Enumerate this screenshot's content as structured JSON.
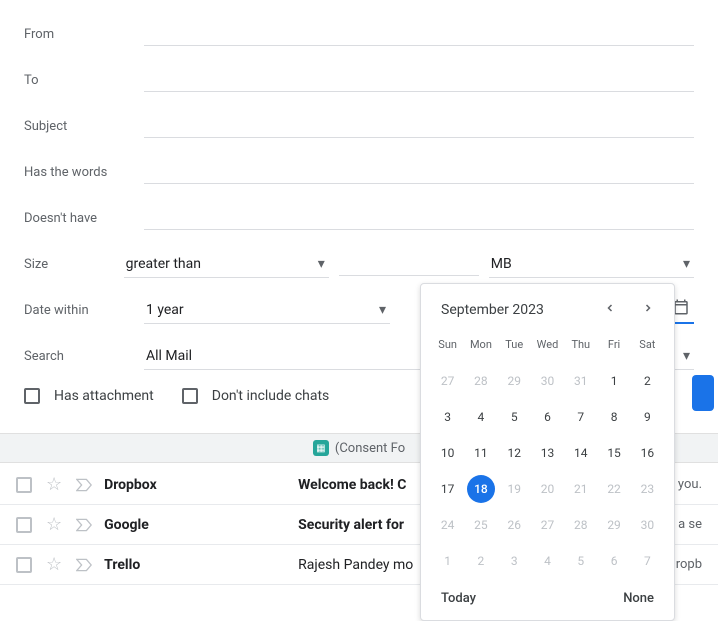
{
  "form": {
    "from_label": "From",
    "from_value": "",
    "to_label": "To",
    "to_value": "",
    "subject_label": "Subject",
    "subject_value": "",
    "has_words_label": "Has the words",
    "has_words_value": "",
    "doesnt_have_label": "Doesn't have",
    "doesnt_have_value": "",
    "size_label": "Size",
    "size_op": "greater than",
    "size_value": "",
    "size_unit": "MB",
    "date_within_label": "Date within",
    "date_within_value": "1 year",
    "date_value": "2023/09/18",
    "search_label": "Search",
    "search_value": "All Mail",
    "has_attachment_label": "Has attachment",
    "dont_include_chats_label": "Don't include chats"
  },
  "datepicker": {
    "title": "September 2023",
    "dow": [
      "Sun",
      "Mon",
      "Tue",
      "Wed",
      "Thu",
      "Fri",
      "Sat"
    ],
    "selected": 18,
    "today_label": "Today",
    "none_label": "None",
    "weeks": [
      [
        {
          "n": 27,
          "m": true
        },
        {
          "n": 28,
          "m": true
        },
        {
          "n": 29,
          "m": true
        },
        {
          "n": 30,
          "m": true
        },
        {
          "n": 31,
          "m": true
        },
        {
          "n": 1
        },
        {
          "n": 2
        }
      ],
      [
        {
          "n": 3
        },
        {
          "n": 4
        },
        {
          "n": 5
        },
        {
          "n": 6
        },
        {
          "n": 7
        },
        {
          "n": 8
        },
        {
          "n": 9
        }
      ],
      [
        {
          "n": 10
        },
        {
          "n": 11
        },
        {
          "n": 12
        },
        {
          "n": 13
        },
        {
          "n": 14
        },
        {
          "n": 15
        },
        {
          "n": 16
        }
      ],
      [
        {
          "n": 17
        },
        {
          "n": 18,
          "sel": true
        },
        {
          "n": 19,
          "m": true
        },
        {
          "n": 20,
          "m": true
        },
        {
          "n": 21,
          "m": true
        },
        {
          "n": 22,
          "m": true
        },
        {
          "n": 23,
          "m": true
        }
      ],
      [
        {
          "n": 24,
          "m": true
        },
        {
          "n": 25,
          "m": true
        },
        {
          "n": 26,
          "m": true
        },
        {
          "n": 27,
          "m": true
        },
        {
          "n": 28,
          "m": true
        },
        {
          "n": 29,
          "m": true
        },
        {
          "n": 30,
          "m": true
        }
      ],
      [
        {
          "n": 1,
          "m": true
        },
        {
          "n": 2,
          "m": true
        },
        {
          "n": 3,
          "m": true
        },
        {
          "n": 4,
          "m": true
        },
        {
          "n": 5,
          "m": true
        },
        {
          "n": 6,
          "m": true
        },
        {
          "n": 7,
          "m": true
        }
      ]
    ]
  },
  "consent": "(Consent Fo",
  "emails": [
    {
      "sender": "Dropbox",
      "subject": "Welcome back! C",
      "trail": "or you.",
      "bold": true
    },
    {
      "sender": "Google",
      "subject": "Security alert for",
      "trail": "of a se",
      "bold": true
    },
    {
      "sender": "Trello",
      "subject": "Rajesh Pandey mo",
      "trail": "Dropb",
      "bold": false
    }
  ]
}
